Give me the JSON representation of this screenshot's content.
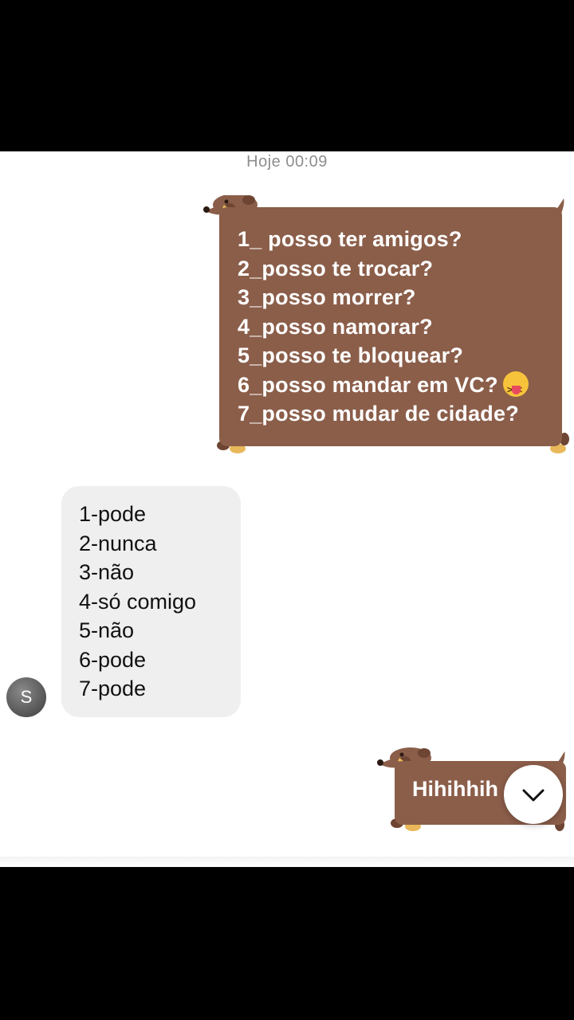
{
  "chat": {
    "timestamp": "Hoje 00:09",
    "sent_message_1": {
      "lines": [
        "1_ posso ter amigos?",
        "2_posso te trocar?",
        "3_posso morrer?",
        "4_posso namorar?",
        "5_posso te bloquear?",
        "6_posso mandar em VC?",
        "7_posso mudar de cidade?"
      ],
      "emoji": "squinting-face-with-tongue"
    },
    "received_message": {
      "lines": [
        "1-pode",
        "2-nunca",
        "3-não",
        "4-só comigo",
        "5-não",
        "6-pode",
        "7-pode"
      ]
    },
    "avatar_initial": "S",
    "sent_message_2": {
      "text": "Hihihhih"
    },
    "scroll_button_icon": "chevron-down-icon"
  },
  "colors": {
    "sent_bubble": "#8b5e4a",
    "received_bubble": "#efefef"
  }
}
